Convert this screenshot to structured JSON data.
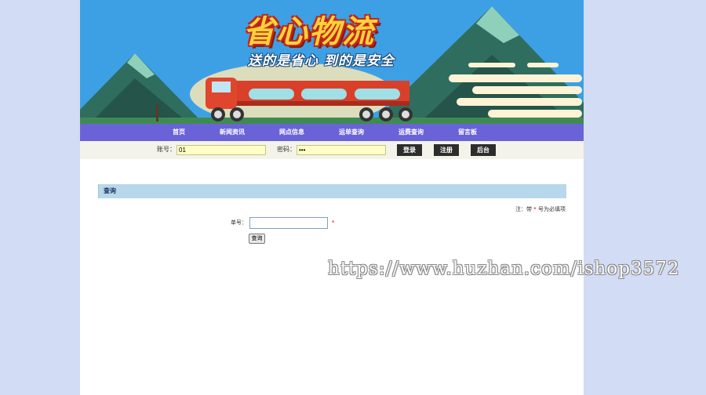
{
  "banner": {
    "title": "省心物流",
    "slogan": "送的是省心  到的是安全"
  },
  "nav": {
    "items": [
      "首页",
      "新闻资讯",
      "网点信息",
      "运单查询",
      "运费查询",
      "留言板"
    ]
  },
  "login": {
    "account_label": "账号：",
    "account_value": "01",
    "password_label": "密码：",
    "password_value": "•••",
    "login_button": "登录",
    "register_button": "注册",
    "admin_button": "后台"
  },
  "query": {
    "title": "查询",
    "note_prefix": "注：带",
    "note_star": "*",
    "note_suffix": "号为必填项",
    "order_label": "单号：",
    "order_value": "",
    "required_star": "*",
    "submit_button": "查询"
  },
  "watermark": "https://www.huzhan.com/ishop3572",
  "colors": {
    "background": "#d3dcf5",
    "nav": "#6a63d8",
    "login_bar": "#f4f3ea",
    "section_header": "#b7d7eb",
    "input_yellow": "#ffffc6"
  }
}
